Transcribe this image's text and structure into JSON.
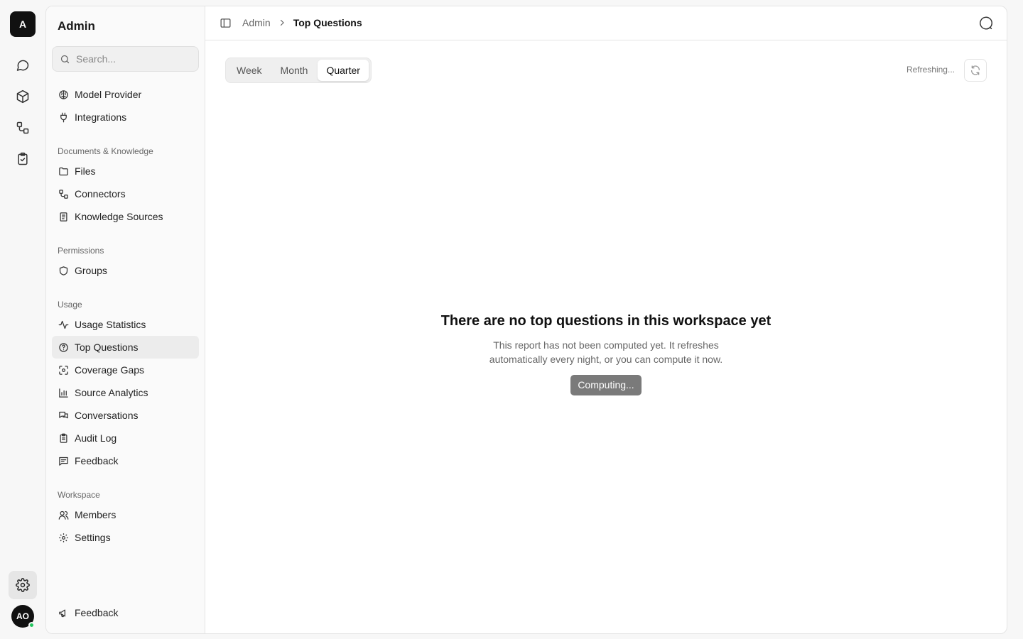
{
  "rail": {
    "workspace_initial": "A",
    "user_initials": "AO",
    "icons": [
      "chat-icon",
      "cube-icon",
      "connectors-icon",
      "clipboard-check-icon",
      "gear-icon"
    ]
  },
  "sidebar": {
    "title": "Admin",
    "search_placeholder": "Search...",
    "top_items": [
      {
        "label": "Model Provider",
        "icon": "brain-icon"
      },
      {
        "label": "Integrations",
        "icon": "plug-icon"
      }
    ],
    "sections": [
      {
        "title": "Documents & Knowledge",
        "items": [
          {
            "label": "Files",
            "icon": "folder-icon"
          },
          {
            "label": "Connectors",
            "icon": "connectors-icon"
          },
          {
            "label": "Knowledge Sources",
            "icon": "book-icon"
          }
        ]
      },
      {
        "title": "Permissions",
        "items": [
          {
            "label": "Groups",
            "icon": "shield-icon"
          }
        ]
      },
      {
        "title": "Usage",
        "items": [
          {
            "label": "Usage Statistics",
            "icon": "activity-icon"
          },
          {
            "label": "Top Questions",
            "icon": "help-circle-icon",
            "active": true
          },
          {
            "label": "Coverage Gaps",
            "icon": "scan-icon"
          },
          {
            "label": "Source Analytics",
            "icon": "bar-chart-icon"
          },
          {
            "label": "Conversations",
            "icon": "messages-icon"
          },
          {
            "label": "Audit Log",
            "icon": "clipboard-icon"
          },
          {
            "label": "Feedback",
            "icon": "message-text-icon"
          }
        ]
      },
      {
        "title": "Workspace",
        "items": [
          {
            "label": "Members",
            "icon": "users-icon"
          },
          {
            "label": "Settings",
            "icon": "gear-icon"
          }
        ]
      }
    ],
    "footer_item": {
      "label": "Feedback",
      "icon": "megaphone-icon"
    }
  },
  "header": {
    "breadcrumb": [
      "Admin",
      "Top Questions"
    ]
  },
  "period_tabs": {
    "options": [
      "Week",
      "Month",
      "Quarter"
    ],
    "selected": "Quarter"
  },
  "refresh": {
    "status": "Refreshing..."
  },
  "empty_state": {
    "title": "There are no top questions in this workspace yet",
    "description": "This report has not been computed yet. It refreshes automatically every night, or you can compute it now.",
    "button_label": "Computing..."
  }
}
